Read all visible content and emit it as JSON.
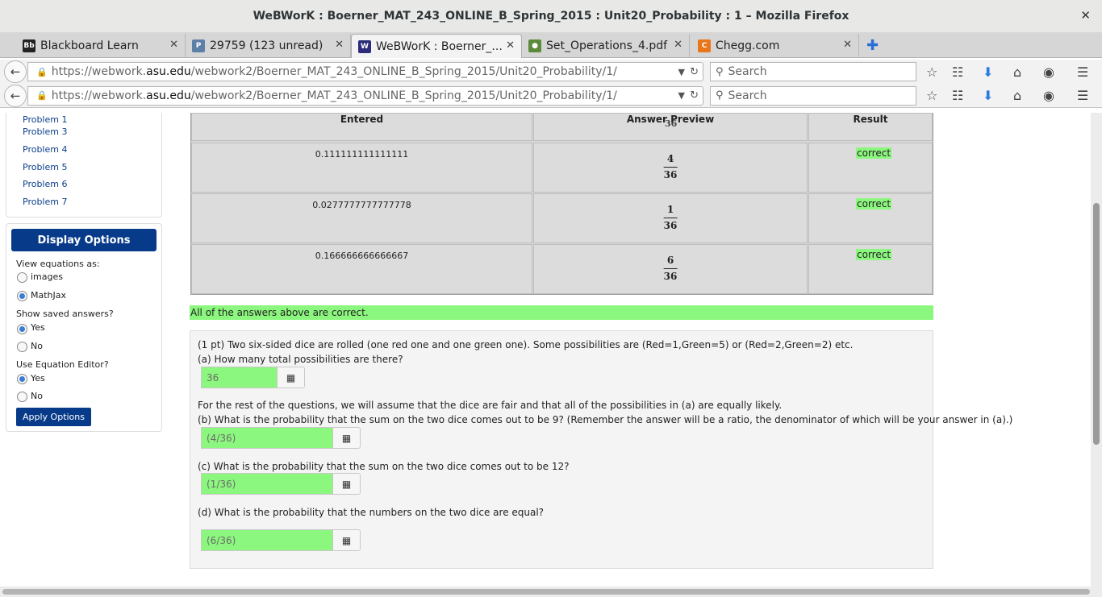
{
  "window": {
    "title": "WeBWorK : Boerner_MAT_243_ONLINE_B_Spring_2015 : Unit20_Probability : 1 – Mozilla Firefox",
    "close": "✕"
  },
  "tabs": [
    {
      "label": "Blackboard Learn",
      "favicon": "Bb",
      "color": "#222222"
    },
    {
      "label": "29759 (123 unread)",
      "favicon": "P",
      "color": "#5d7fa8"
    },
    {
      "label": "WeBWorK : Boerner_...",
      "favicon": "W",
      "color": "#2c2c7a"
    },
    {
      "label": "Set_Operations_4.pdf",
      "favicon": "●",
      "color": "#5a8a3a"
    },
    {
      "label": "Chegg.com",
      "favicon": "C",
      "color": "#e8761b"
    }
  ],
  "tab_close": "✕",
  "new_tab": "✚",
  "nav": {
    "url_prefix": "https://webwork.",
    "url_host": "asu.edu",
    "url_path": "/webwork2/Boerner_MAT_243_ONLINE_B_Spring_2015/Unit20_Probability/1/",
    "search_placeholder": "Search"
  },
  "sidebar": {
    "problems": [
      "Problem 1",
      "Problem 3",
      "Problem 4",
      "Problem 5",
      "Problem 6",
      "Problem 7"
    ],
    "display_options_title": "Display Options",
    "view_equations_label": "View equations as:",
    "view_equations_options": [
      "images",
      "MathJax"
    ],
    "show_saved_label": "Show saved answers?",
    "show_saved_options": [
      "Yes",
      "No"
    ],
    "equation_editor_label": "Use Equation Editor?",
    "equation_editor_options": [
      "Yes",
      "No"
    ],
    "apply_label": "Apply Options"
  },
  "results": {
    "headers": [
      "Entered",
      "Answer Preview",
      "Result"
    ],
    "header_overlap": "36",
    "rows": [
      {
        "entered": "0.111111111111111",
        "num": "4",
        "den": "36",
        "result": "correct"
      },
      {
        "entered": "0.0277777777777778",
        "num": "1",
        "den": "36",
        "result": "correct"
      },
      {
        "entered": "0.166666666666667",
        "num": "6",
        "den": "36",
        "result": "correct"
      }
    ],
    "summary": "All of the answers above are correct."
  },
  "problem": {
    "intro": "(1 pt) Two six-sided dice are rolled (one red one and one green one). Some possibilities are (Red=1,Green=5) or (Red=2,Green=2) etc.",
    "a_question": "(a) How many total possibilities are there?",
    "a_answer": "36",
    "rest": "For the rest of the questions, we will assume that the dice are fair and that all of the possibilities in (a) are equally likely.",
    "b_question": "(b) What is the probability that the sum on the two dice comes out to be 9? (Remember the answer will be a ratio, the denominator of which will be your answer in (a).)",
    "b_answer": "(4/36)",
    "c_question": "(c) What is the probability that the sum on the two dice comes out to be 12?",
    "c_answer": "(1/36)",
    "d_question": "(d) What is the probability that the numbers on the two dice are equal?",
    "d_answer": "(6/36)",
    "eq_icon": "▦"
  }
}
